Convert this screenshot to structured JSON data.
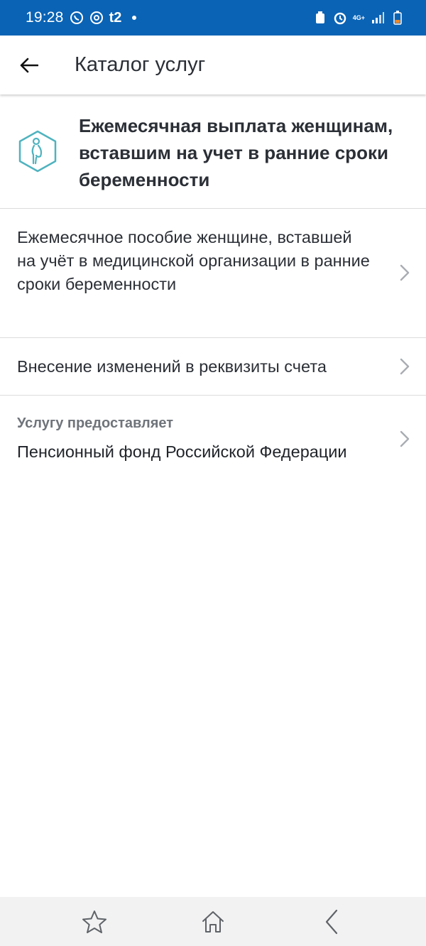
{
  "status_bar": {
    "time": "19:28",
    "carrier": "t2",
    "network": "4G+",
    "colors": {
      "background": "#0a63b5"
    }
  },
  "app_bar": {
    "title": "Каталог услуг",
    "back_icon": "arrow-left-icon"
  },
  "service": {
    "icon": "pregnant-woman-icon",
    "title": "Ежемесячная выплата женщинам, вставшим на учет в ранние сроки беременности",
    "icon_color": "#4fb3bf"
  },
  "items": [
    {
      "label": "Ежемесячное пособие женщине, вставшей на учёт в медицинской организации в ранние сроки беременности"
    },
    {
      "label": "Внесение изменений в реквизиты счета"
    }
  ],
  "provider": {
    "label": "Услугу предоставляет",
    "name": "Пенсионный фонд Российской Федерации"
  },
  "bottom_nav": {
    "icons": [
      "star-icon",
      "home-icon",
      "back-chevron-icon"
    ]
  }
}
